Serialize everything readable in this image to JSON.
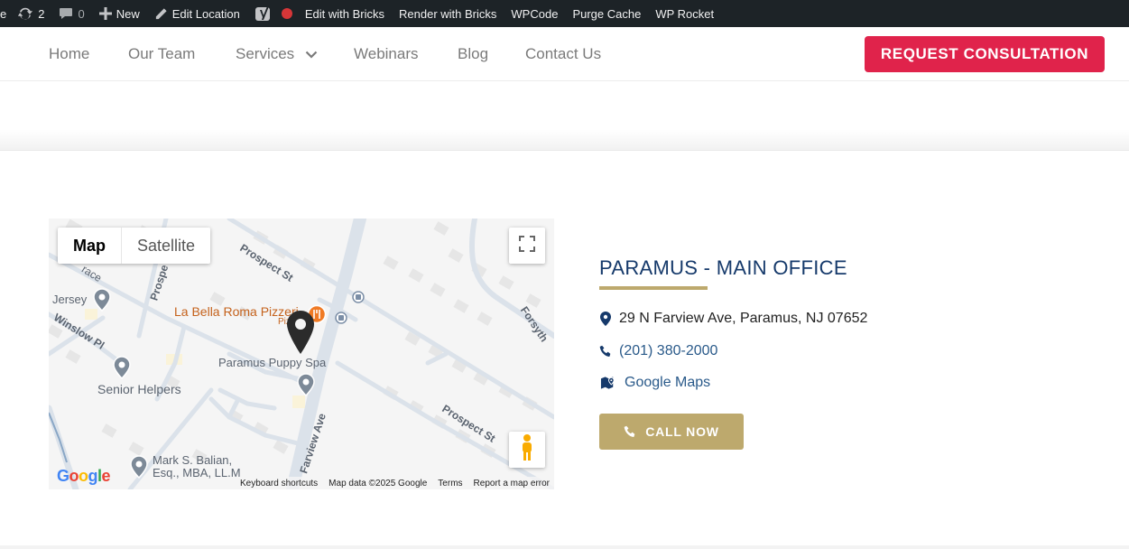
{
  "admin_bar": {
    "partial_left": "e",
    "updates_count": "2",
    "comments_count": "0",
    "new_label": "New",
    "edit_location_label": "Edit Location",
    "edit_bricks_label": "Edit with Bricks",
    "render_bricks_label": "Render with Bricks",
    "wpcode_label": "WPCode",
    "purge_cache_label": "Purge Cache",
    "wp_rocket_label": "WP Rocket",
    "status_dot_color": "#d63638"
  },
  "nav": {
    "items": [
      {
        "label": "Home"
      },
      {
        "label": "Our Team"
      },
      {
        "label": "Services"
      },
      {
        "label": "Webinars"
      },
      {
        "label": "Blog"
      },
      {
        "label": "Contact Us"
      }
    ],
    "cta_label": "REQUEST CONSULTATION",
    "cta_color": "#e0234b"
  },
  "map": {
    "type_controls": {
      "map_label": "Map",
      "satellite_label": "Satellite",
      "active": "Map"
    },
    "labels": {
      "jersey": "Jersey",
      "race": "race",
      "prospect_left": "Prospe",
      "prospect_st_top": "Prospect St",
      "winslow": "Winslow Pl",
      "la_bella": "La Bella Roma Pizzeri",
      "pizza": "Pizza",
      "forsyth": "Forsyth",
      "puppy_spa": "Paramus Puppy Spa",
      "senior_helpers": "Senior Helpers",
      "farview_ave": "Farview Ave",
      "prospect_st_bottom": "Prospect St",
      "balian_1": "Mark S. Balian,",
      "balian_2": "Esq., MBA, LL.M"
    },
    "footer": {
      "keyboard": "Keyboard shortcuts",
      "map_data": "Map data ©2025 Google",
      "terms": "Terms",
      "report": "Report a map error"
    },
    "logo_letters": [
      "G",
      "o",
      "o",
      "g",
      "l",
      "e"
    ]
  },
  "office": {
    "title": "PARAMUS - MAIN OFFICE",
    "address": "29 N Farview Ave, Paramus, NJ 07652",
    "phone": "(201) 380-2000",
    "maps_link": "Google Maps",
    "call_label": "CALL NOW",
    "title_color": "#163a6b",
    "accent_color": "#bda96d"
  }
}
